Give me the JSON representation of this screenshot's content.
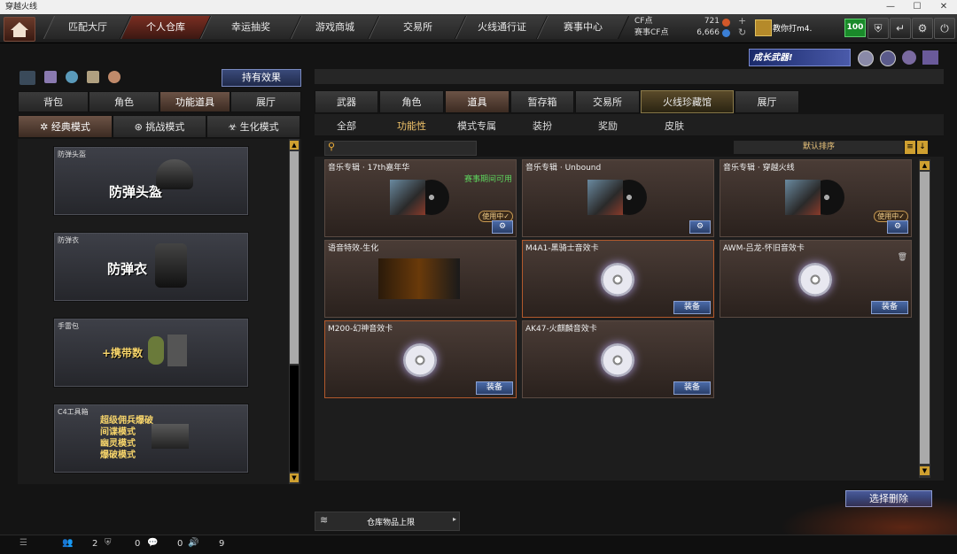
{
  "window": {
    "title": "穿越火线",
    "min": "—",
    "max": "☐",
    "close": "✕"
  },
  "nav": {
    "tabs": [
      "匹配大厅",
      "个人仓库",
      "幸运抽奖",
      "游戏商城",
      "交易所",
      "火线通行证",
      "赛事中心"
    ],
    "active": 1
  },
  "currency": {
    "cf_label": "CF点",
    "cf_value": "721",
    "event_label": "赛事CF点",
    "event_value": "6,666",
    "plus": "+",
    "refresh": "↻"
  },
  "user": {
    "name": "教你打m4.",
    "level": "100"
  },
  "left": {
    "effects_button": "持有效果",
    "tabs": [
      "背包",
      "角色",
      "功能道具",
      "展厅"
    ],
    "active_tab": 2,
    "modes": [
      "经典模式",
      "挑战模式",
      "生化模式"
    ],
    "active_mode": 0,
    "cards": [
      {
        "small": "防弹头盔",
        "big": "防弹头盔"
      },
      {
        "small": "防弹衣",
        "big": "防弹衣"
      },
      {
        "small": "手雷包",
        "big": "+携带数"
      },
      {
        "small": "C4工具箱",
        "lines": [
          "超级佣兵爆破",
          "间谍模式",
          "幽灵模式",
          "爆破模式"
        ]
      }
    ]
  },
  "banner": {
    "text": "成长武器!"
  },
  "right": {
    "tabs": [
      "武器",
      "角色",
      "道具",
      "暂存箱",
      "交易所",
      "火线珍藏馆",
      "展厅"
    ],
    "active_tab": 2,
    "highlight_tab": 5,
    "subtabs": [
      "全部",
      "功能性",
      "模式专属",
      "装扮",
      "奖励",
      "皮肤"
    ],
    "active_subtab": 1,
    "search_placeholder": "",
    "sort_label": "默认排序",
    "items": [
      {
        "name": "音乐专辑 · 17th嘉年华",
        "tag": "赛事期间可用",
        "status": "使用中✓",
        "button": "⚙"
      },
      {
        "name": "音乐专辑 · Unbound",
        "button": "⚙"
      },
      {
        "name": "音乐专辑 · 穿越火线",
        "status": "使用中✓",
        "button": "⚙"
      },
      {
        "name": "语音特效-生化"
      },
      {
        "name": "M4A1-黑骑士音效卡",
        "button": "装备"
      },
      {
        "name": "AWM-吕龙-怀旧音效卡",
        "button": "装备"
      },
      {
        "name": "M200-幻神音效卡",
        "button": "装备"
      },
      {
        "name": "AK47-火麒麟音效卡",
        "button": "装备"
      }
    ],
    "delete_button": "选择删除",
    "capacity_label": "仓库物品上限"
  },
  "status": {
    "friends": "2",
    "shield": "0",
    "chat": "0",
    "volume": "9"
  }
}
